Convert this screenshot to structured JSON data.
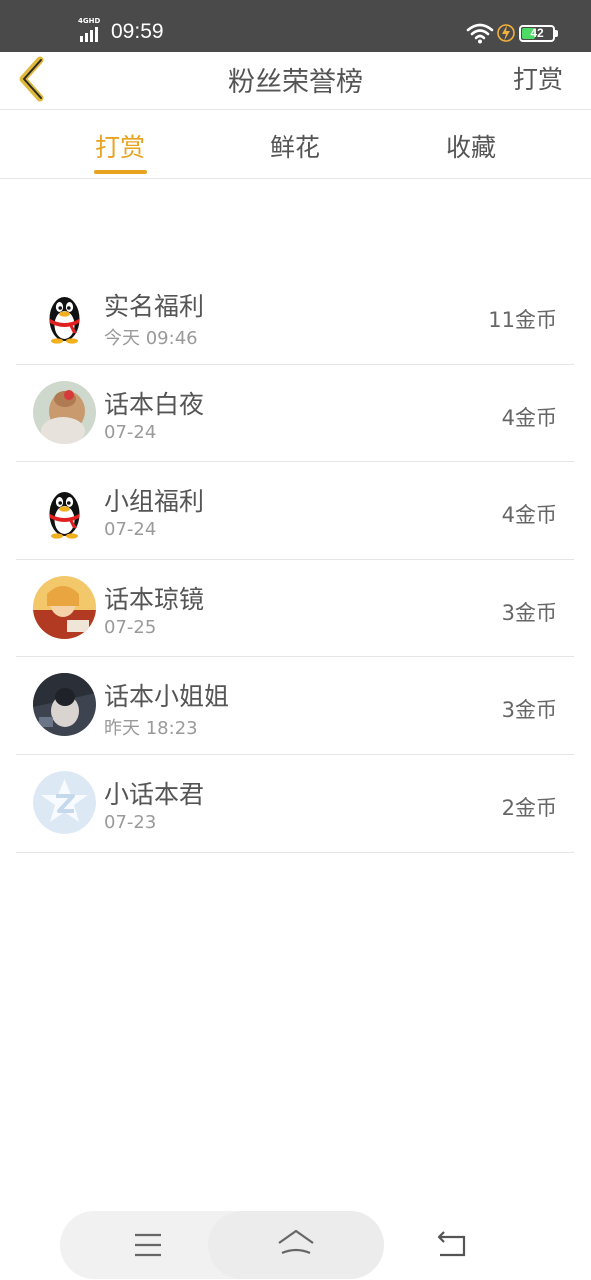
{
  "status_bar": {
    "network": "4GHD",
    "time": "09:59",
    "battery": "42",
    "battery_level": 0.42
  },
  "header": {
    "back_icon": "chevron-left-icon",
    "title": "粉丝荣誉榜",
    "right_action": "打赏"
  },
  "tabs": [
    {
      "label": "打赏",
      "active": true
    },
    {
      "label": "鲜花",
      "active": false
    },
    {
      "label": "收藏",
      "active": false
    }
  ],
  "fans": [
    {
      "name": "实名福利",
      "time": "今天 09:46",
      "coins": "11金币",
      "avatar": "penguin-avatar"
    },
    {
      "name": "话本白夜",
      "time": "07-24",
      "coins": "4金币",
      "avatar": "photo-avatar"
    },
    {
      "name": "小组福利",
      "time": "07-24",
      "coins": "4金币",
      "avatar": "penguin-avatar"
    },
    {
      "name": "话本琼镜",
      "time": "07-25",
      "coins": "3金币",
      "avatar": "photo-avatar"
    },
    {
      "name": "话本小姐姐",
      "time": "昨天 18:23",
      "coins": "3金币",
      "avatar": "photo-avatar"
    },
    {
      "name": "小话本君",
      "time": "07-23",
      "coins": "2金币",
      "avatar": "z-logo-avatar"
    }
  ],
  "nav_bar": {
    "menu_icon": "menu-icon",
    "home_icon": "home-icon",
    "back_icon": "back-arrow-icon"
  },
  "colors": {
    "accent": "#e8a321",
    "status_bar": "#4a4a4a",
    "divider": "#e6e6e6"
  }
}
